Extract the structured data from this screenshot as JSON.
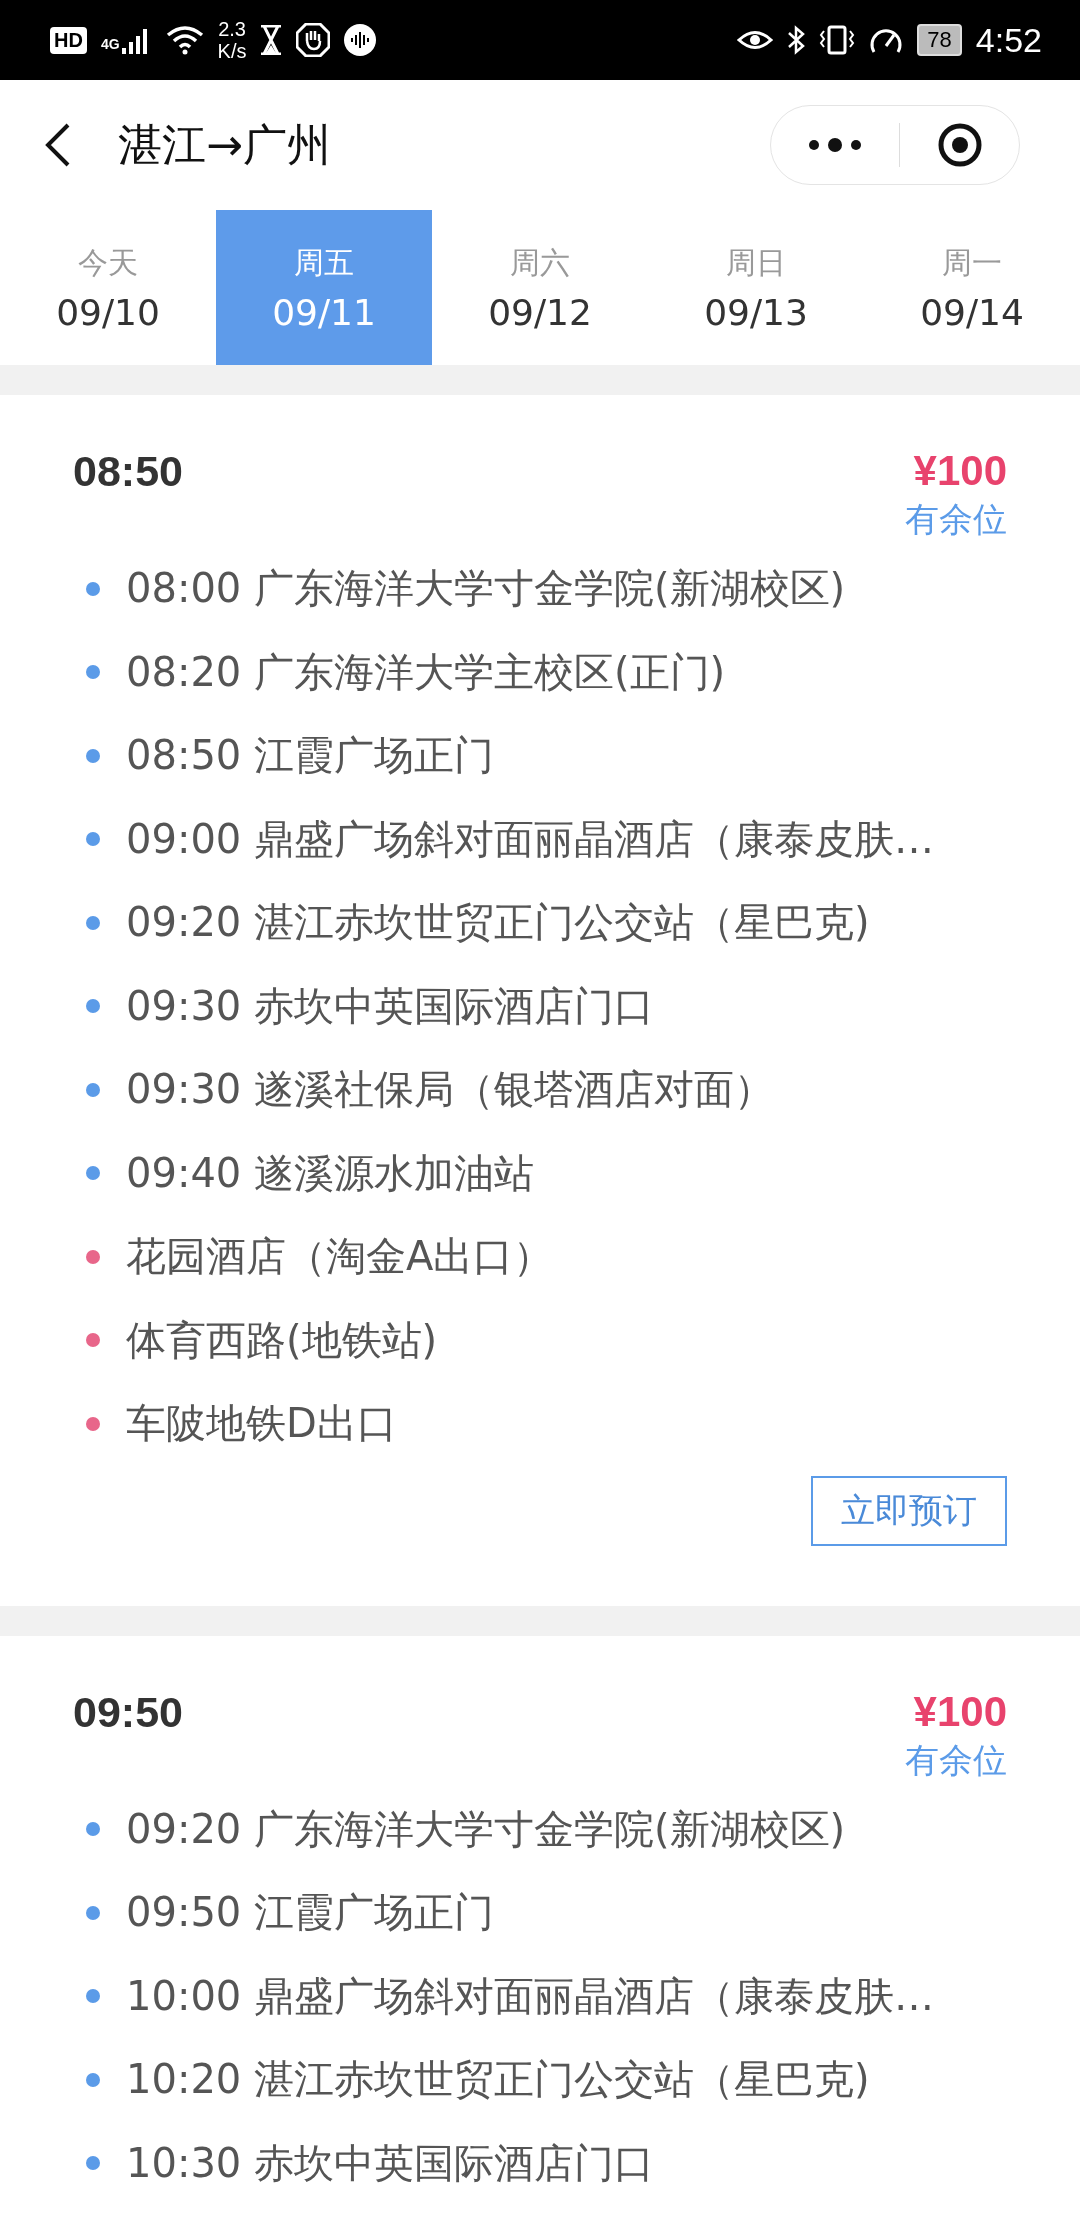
{
  "status_bar": {
    "hd": "HD",
    "network": "4G",
    "speed_value": "2.3",
    "speed_unit": "K/s",
    "battery": "78",
    "time": "4:52"
  },
  "header": {
    "title": "湛江→广州"
  },
  "date_tabs": [
    {
      "day": "今天",
      "date": "09/10",
      "selected": false
    },
    {
      "day": "周五",
      "date": "09/11",
      "selected": true
    },
    {
      "day": "周六",
      "date": "09/12",
      "selected": false
    },
    {
      "day": "周日",
      "date": "09/13",
      "selected": false
    },
    {
      "day": "周一",
      "date": "09/14",
      "selected": false
    }
  ],
  "trips": [
    {
      "departure": "08:50",
      "price": "¥100",
      "availability": "有余位",
      "book_button": "立即预订",
      "stops": [
        {
          "text": "08:00 广东海洋大学寸金学院(新湖校区)",
          "color": "#5b9be8"
        },
        {
          "text": "08:20 广东海洋大学主校区(正门)",
          "color": "#5b9be8"
        },
        {
          "text": "08:50 江霞广场正门",
          "color": "#5b9be8"
        },
        {
          "text": "09:00 鼎盛广场斜对面丽晶酒店（康泰皮肤…",
          "color": "#5b9be8"
        },
        {
          "text": "09:20 湛江赤坎世贸正门公交站（星巴克)",
          "color": "#5b9be8"
        },
        {
          "text": "09:30 赤坎中英国际酒店门口",
          "color": "#5b9be8"
        },
        {
          "text": "09:30 遂溪社保局（银塔酒店对面）",
          "color": "#5b9be8"
        },
        {
          "text": "09:40 遂溪源水加油站",
          "color": "#5b9be8"
        },
        {
          "text": "花园酒店（淘金A出口）",
          "color": "#e8668a"
        },
        {
          "text": "体育西路(地铁站)",
          "color": "#e8668a"
        },
        {
          "text": "车陂地铁D出口",
          "color": "#e8668a"
        }
      ]
    },
    {
      "departure": "09:50",
      "price": "¥100",
      "availability": "有余位",
      "stops": [
        {
          "text": "09:20 广东海洋大学寸金学院(新湖校区)",
          "color": "#5b9be8"
        },
        {
          "text": "09:50 江霞广场正门",
          "color": "#5b9be8"
        },
        {
          "text": "10:00 鼎盛广场斜对面丽晶酒店（康泰皮肤…",
          "color": "#5b9be8"
        },
        {
          "text": "10:20 湛江赤坎世贸正门公交站（星巴克)",
          "color": "#5b9be8"
        },
        {
          "text": "10:30 赤坎中英国际酒店门口",
          "color": "#5b9be8"
        }
      ]
    }
  ]
}
